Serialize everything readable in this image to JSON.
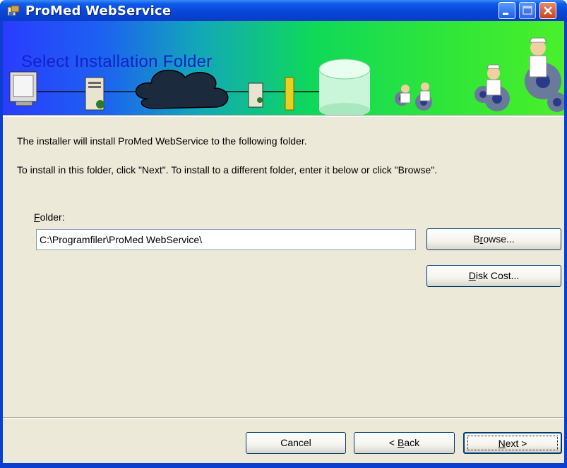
{
  "window": {
    "title": "ProMed WebService",
    "accent_color": "#0a3fd0",
    "icon": "installer-app-icon"
  },
  "titlebar_buttons": {
    "minimize": "minimize-icon",
    "maximize": "maximize-icon",
    "close": "close-icon"
  },
  "banner": {
    "title": "Select Installation Folder",
    "illustration": [
      "monitor-icon",
      "server-icon",
      "cloud-icon",
      "server-icon",
      "firewall-icon",
      "database-icon",
      "doctor-gear-icon"
    ]
  },
  "body": {
    "intro": "The installer will install ProMed WebService to the following folder.",
    "instructions": "To install in this folder, click \"Next\". To install to a different folder, enter it below or click \"Browse\"."
  },
  "folder": {
    "label_mnemonic": "F",
    "label_rest": "older:",
    "value": "C:\\Programfiler\\ProMed WebService\\"
  },
  "buttons": {
    "browse_pre": "B",
    "browse_mnemonic": "r",
    "browse_post": "owse...",
    "diskcost_mnemonic": "D",
    "diskcost_post": "isk Cost...",
    "cancel": "Cancel",
    "back_pre": "< ",
    "back_mnemonic": "B",
    "back_post": "ack",
    "next_mnemonic": "N",
    "next_post": "ext >"
  }
}
